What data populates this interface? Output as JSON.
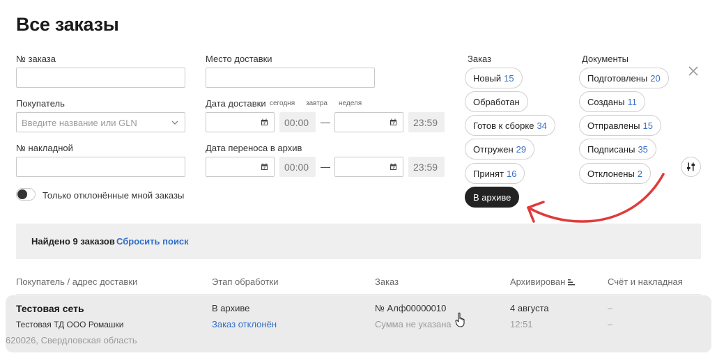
{
  "page_title": "Все заказы",
  "filters": {
    "order_number_label": "№ заказа",
    "delivery_place_label": "Место доставки",
    "buyer_label": "Покупатель",
    "buyer_placeholder": "Введите название или GLN",
    "delivery_date_label": "Дата доставки",
    "quick_today": "сегодня",
    "quick_tomorrow": "завтра",
    "quick_week": "неделя",
    "time_from": "00:00",
    "time_to": "23:59",
    "dash": "—",
    "invoice_label": "№ накладной",
    "archive_date_label": "Дата переноса в архив",
    "only_rejected_label": "Только отклонённые мной заказы"
  },
  "order_group": {
    "title": "Заказ",
    "chips": [
      {
        "label": "Новый",
        "count": "15"
      },
      {
        "label": "Обработан",
        "count": ""
      },
      {
        "label": "Готов к сборке",
        "count": "34"
      },
      {
        "label": "Отгружен",
        "count": "29"
      },
      {
        "label": "Принят",
        "count": "16"
      },
      {
        "label": "В архиве",
        "count": ""
      }
    ]
  },
  "docs_group": {
    "title": "Документы",
    "chips": [
      {
        "label": "Подготовлены",
        "count": "20"
      },
      {
        "label": "Созданы",
        "count": "11"
      },
      {
        "label": "Отправлены",
        "count": "15"
      },
      {
        "label": "Подписаны",
        "count": "35"
      },
      {
        "label": "Отклонены",
        "count": "2"
      }
    ]
  },
  "results": {
    "found_text": "Найдено 9 заказов",
    "reset_label": "Сбросить поиск"
  },
  "table": {
    "headers": [
      "Покупатель / адрес доставки",
      "Этап обработки",
      "Заказ",
      "Архивирован",
      "Счёт и накладная"
    ],
    "rows": [
      {
        "buyer": "Тестовая сеть",
        "buyer_org": "Тестовая ТД ООО Ромашки",
        "address": "620026, Свердловская область",
        "stage": "В архиве",
        "stage_sub": "Заказ отклонён",
        "order_no": "№ Алф00000010",
        "order_sum": "Сумма не указана",
        "archived_date": "4 августа",
        "archived_time": "12:51",
        "invoice_1": "–",
        "invoice_2": "–"
      }
    ]
  },
  "colors": {
    "accent_link": "#2f6fc9",
    "active_chip": "#222222",
    "annotation_arrow": "#e03a3a"
  }
}
